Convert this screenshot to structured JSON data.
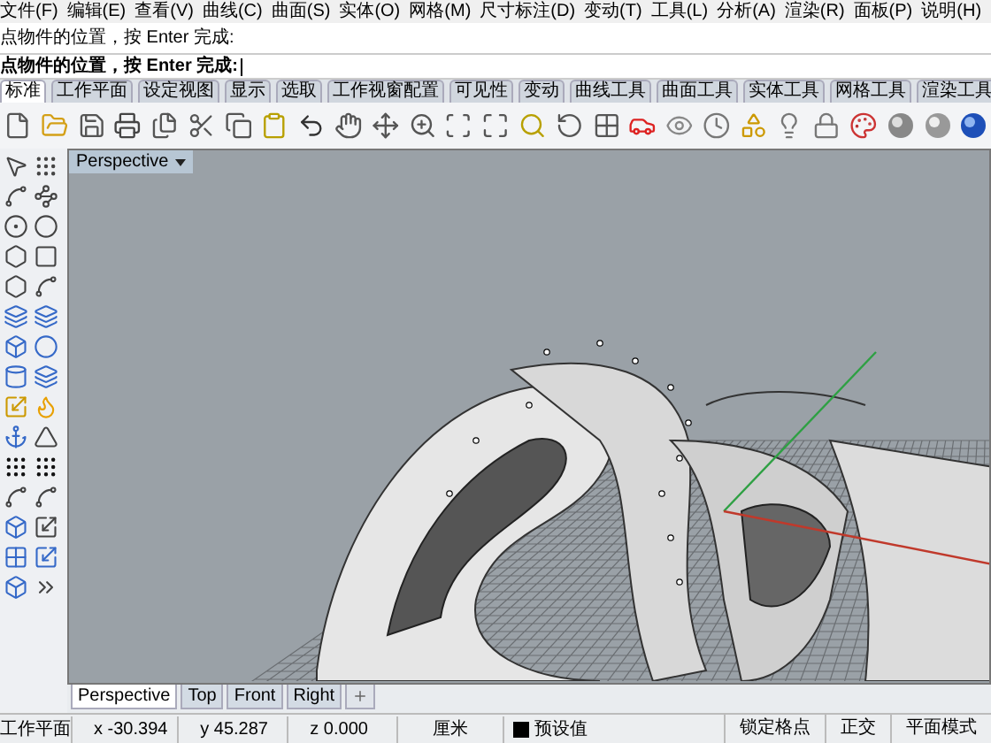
{
  "menu": [
    "文件(F)",
    "编辑(E)",
    "查看(V)",
    "曲线(C)",
    "曲面(S)",
    "实体(O)",
    "网格(M)",
    "尺寸标注(D)",
    "变动(T)",
    "工具(L)",
    "分析(A)",
    "渲染(R)",
    "面板(P)",
    "说明(H)"
  ],
  "command_history": [
    "点物件的位置，按 Enter 完成:"
  ],
  "command_prompt": "点物件的位置，按 Enter 完成:",
  "toolbar_tabs": [
    {
      "label": "标准",
      "selected": true
    },
    {
      "label": "工作平面",
      "selected": false
    },
    {
      "label": "设定视图",
      "selected": false
    },
    {
      "label": "显示",
      "selected": false
    },
    {
      "label": "选取",
      "selected": false
    },
    {
      "label": "工作视窗配置",
      "selected": false
    },
    {
      "label": "可见性",
      "selected": false
    },
    {
      "label": "变动",
      "selected": false
    },
    {
      "label": "曲线工具",
      "selected": false
    },
    {
      "label": "曲面工具",
      "selected": false
    },
    {
      "label": "实体工具",
      "selected": false
    },
    {
      "label": "网格工具",
      "selected": false
    },
    {
      "label": "渲染工具",
      "selected": false
    }
  ],
  "viewport": {
    "title": "Perspective"
  },
  "viewport_tabs": [
    {
      "label": "Perspective",
      "selected": true
    },
    {
      "label": "Top",
      "selected": false
    },
    {
      "label": "Front",
      "selected": false
    },
    {
      "label": "Right",
      "selected": false
    }
  ],
  "status_bar": {
    "cplane": "工作平面",
    "x": "x -30.394",
    "y": "y 45.287",
    "z": "z 0.000",
    "units": "厘米",
    "layer": {
      "name": "预设值",
      "color": "#000000"
    },
    "toggles": [
      "锁定格点",
      "正交",
      "平面模式"
    ]
  }
}
